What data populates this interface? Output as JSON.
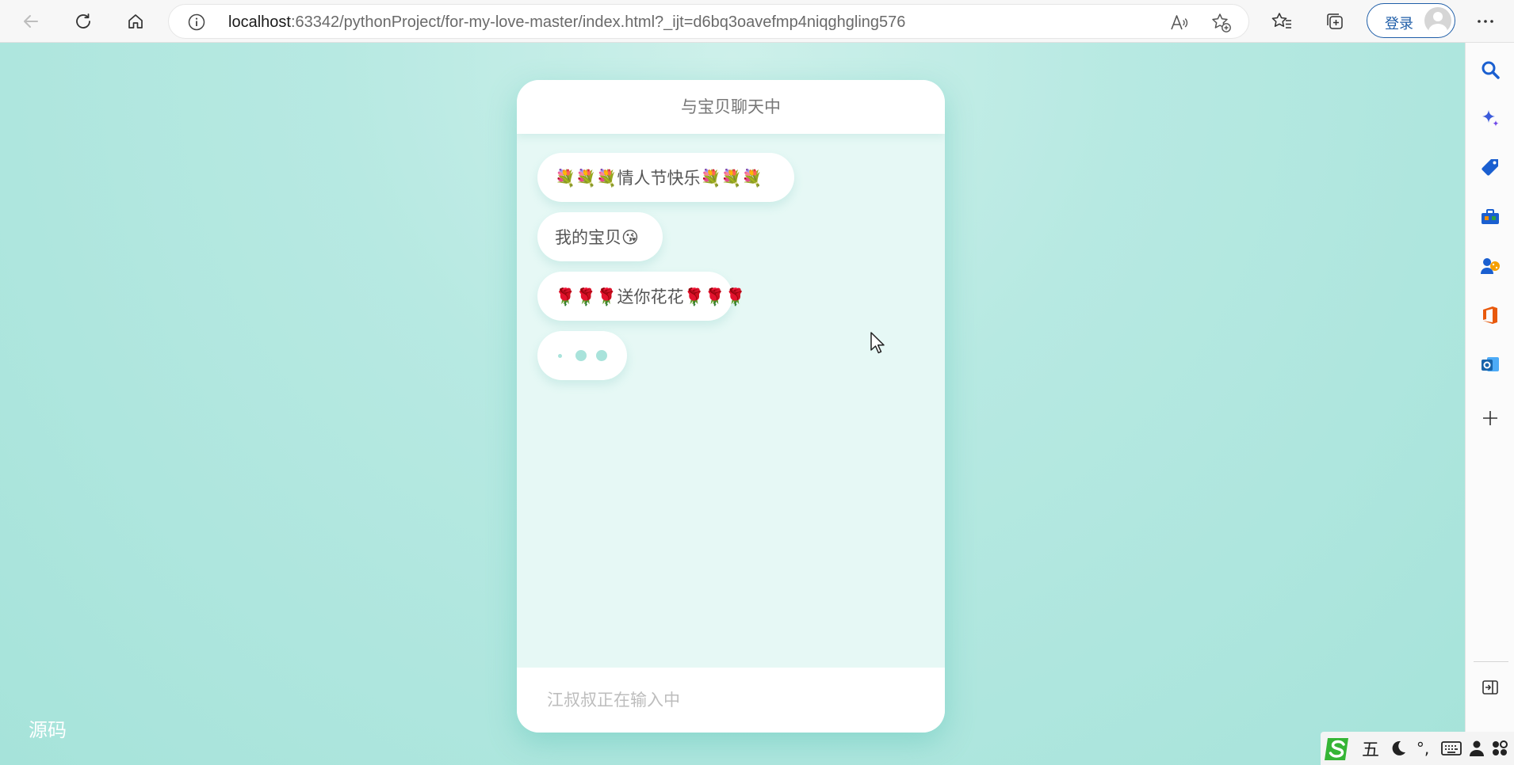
{
  "browser": {
    "url_host": "localhost",
    "url_rest": ":63342/pythonProject/for-my-love-master/index.html?_ijt=d6bq3oavefmp4niqghgling576",
    "login_label": "登录"
  },
  "page": {
    "source_link": "源码"
  },
  "chat": {
    "title": "与宝贝聊天中",
    "messages": [
      "💐💐💐情人节快乐💐💐💐",
      "我的宝贝😘",
      "🌹🌹🌹送你花花🌹🌹🌹"
    ],
    "input_status": "江叔叔正在输入中"
  },
  "ime": {
    "mode_label": "五",
    "punct_label": "°,"
  },
  "colors": {
    "page_bg": "#b7e9e2",
    "chat_bg": "#e6f8f5",
    "typing_dot": "#a9e3db",
    "login_border": "#1f5ea8"
  }
}
